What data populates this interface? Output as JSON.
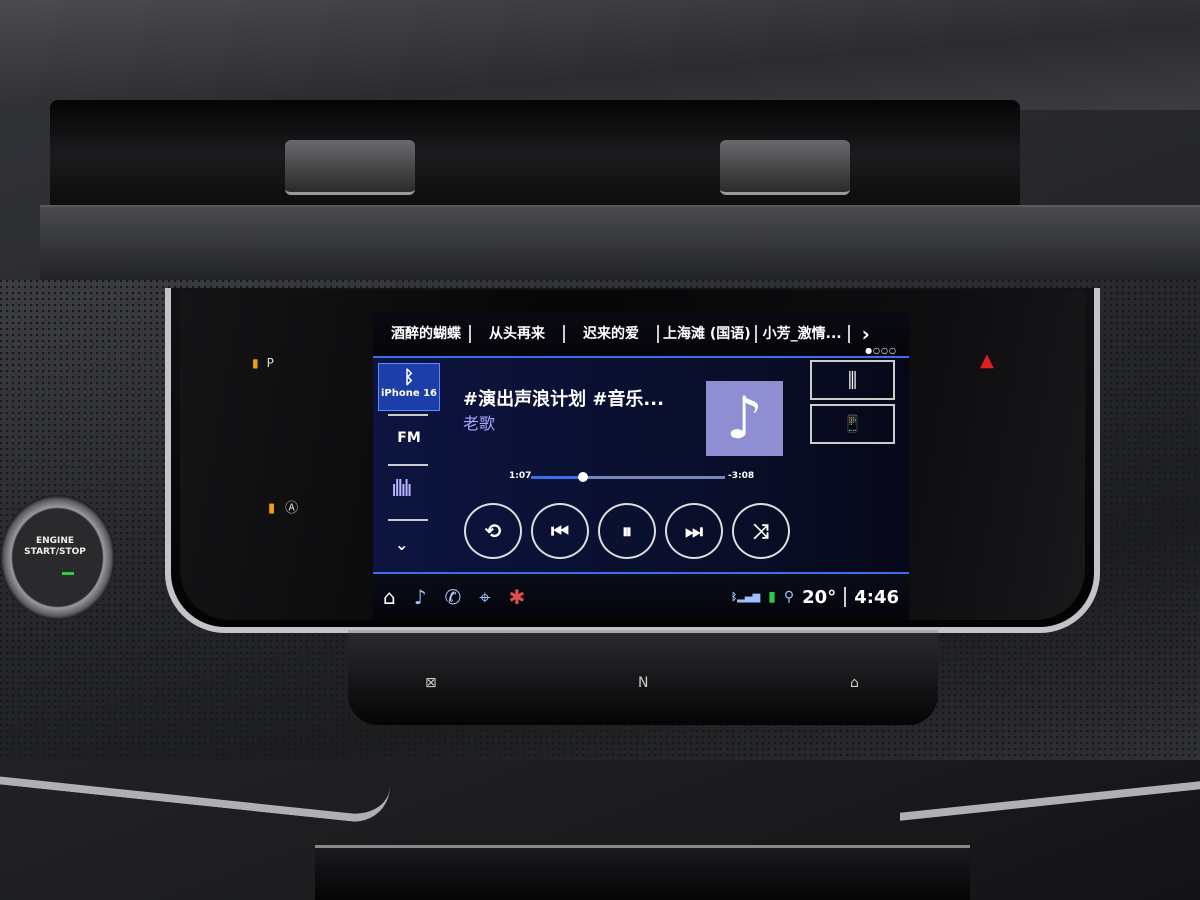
{
  "header_tabs": {
    "items": [
      "酒醉的蝴蝶",
      "从头再来",
      "迟来的爱",
      "上海滩 (国语)",
      "小芳_激情..."
    ],
    "next_icon": "chevron-right-icon",
    "next_glyph": "›",
    "page_dots": "●○○○",
    "current_page": 1,
    "total_pages": 4
  },
  "sources": {
    "bluetooth": {
      "icon": "bluetooth-icon",
      "glyph": "ᛒ",
      "label": "iPhone 16"
    },
    "fm_label": "FM",
    "audio_icon_glyph": "ıllılı",
    "more_glyph": "⌄"
  },
  "now_playing": {
    "title": "#演出声浪计划 #音乐...",
    "artist": "老歌",
    "album_art_glyph": "♪",
    "elapsed": "1:07",
    "remaining": "-3:08",
    "progress_fraction": 0.27
  },
  "controls": {
    "repeat": "⟲",
    "previous": "⏮",
    "pause": "⏸",
    "next": "⏭",
    "shuffle": "⤨"
  },
  "right_buttons": {
    "equalizer": "⫼",
    "phone_audio": "📱"
  },
  "status_bar": {
    "home": "⌂",
    "music": "♪",
    "phone": "✆",
    "nav": "⌖",
    "climate": "✱",
    "bt_signal": "ᛒ▂▄▆",
    "battery": "▮",
    "location": "⚲",
    "temperature": "20°",
    "time": "4:46"
  },
  "dashboard": {
    "park_assist": "P",
    "auto_stop": "Ⓐ",
    "hazard": "▲",
    "engine_label": "ENGINE\nSTART/STOP",
    "lower_buttons": [
      "⊠",
      "N",
      "⌂"
    ]
  },
  "colors": {
    "accent_blue": "#3a6ee8",
    "source_selected": "#1d3ea8",
    "artist_text": "#a9a4ff",
    "album_art": "#8f8ed3",
    "indicator_orange": "#f39c12",
    "hazard_red": "#e02020"
  }
}
